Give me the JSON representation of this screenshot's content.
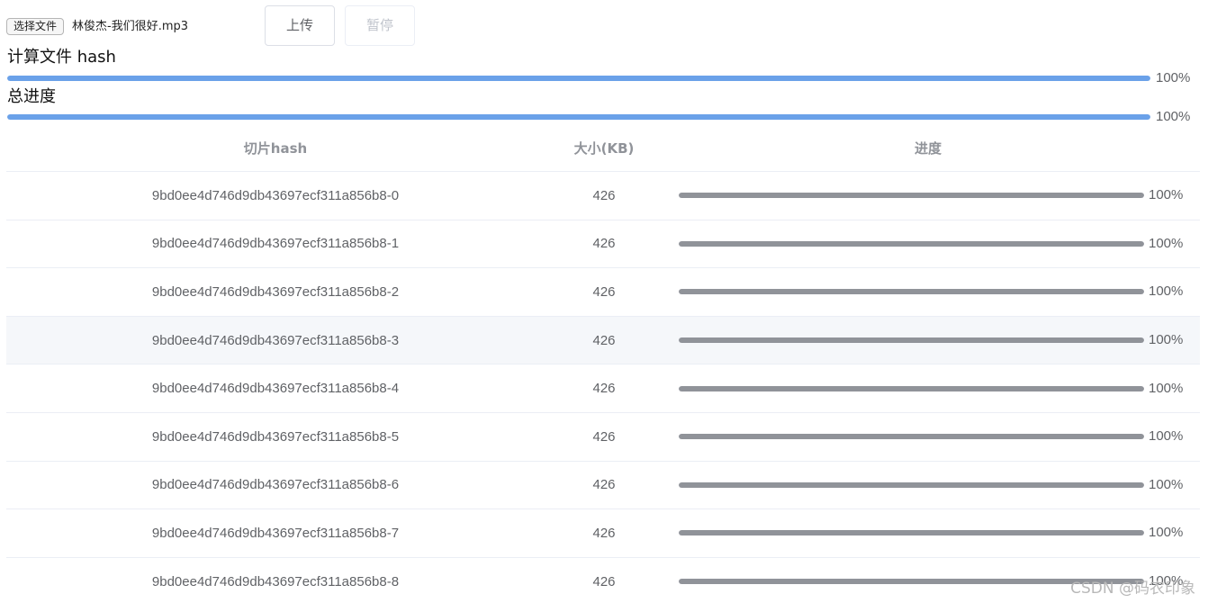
{
  "toolbar": {
    "choose_file_label": "选择文件",
    "file_name": "林俊杰-我们很好.mp3",
    "upload_label": "上传",
    "pause_label": "暂停"
  },
  "hash_progress": {
    "label": "计算文件 hash",
    "percent": 100,
    "text": "100%",
    "color": "#6aa1e9"
  },
  "total_progress": {
    "label": "总进度",
    "percent": 100,
    "text": "100%",
    "color": "#6aa1e9"
  },
  "table": {
    "headers": {
      "hash": "切片hash",
      "size": "大小(KB)",
      "progress": "进度"
    },
    "row_bar_color": "#909399",
    "rows": [
      {
        "hash": "9bd0ee4d746d9db43697ecf311a856b8-0",
        "size": "426",
        "percent": 100,
        "text": "100%"
      },
      {
        "hash": "9bd0ee4d746d9db43697ecf311a856b8-1",
        "size": "426",
        "percent": 100,
        "text": "100%"
      },
      {
        "hash": "9bd0ee4d746d9db43697ecf311a856b8-2",
        "size": "426",
        "percent": 100,
        "text": "100%"
      },
      {
        "hash": "9bd0ee4d746d9db43697ecf311a856b8-3",
        "size": "426",
        "percent": 100,
        "text": "100%"
      },
      {
        "hash": "9bd0ee4d746d9db43697ecf311a856b8-4",
        "size": "426",
        "percent": 100,
        "text": "100%"
      },
      {
        "hash": "9bd0ee4d746d9db43697ecf311a856b8-5",
        "size": "426",
        "percent": 100,
        "text": "100%"
      },
      {
        "hash": "9bd0ee4d746d9db43697ecf311a856b8-6",
        "size": "426",
        "percent": 100,
        "text": "100%"
      },
      {
        "hash": "9bd0ee4d746d9db43697ecf311a856b8-7",
        "size": "426",
        "percent": 100,
        "text": "100%"
      },
      {
        "hash": "9bd0ee4d746d9db43697ecf311a856b8-8",
        "size": "426",
        "percent": 100,
        "text": "100%"
      }
    ]
  },
  "watermark": "CSDN @码农印象"
}
